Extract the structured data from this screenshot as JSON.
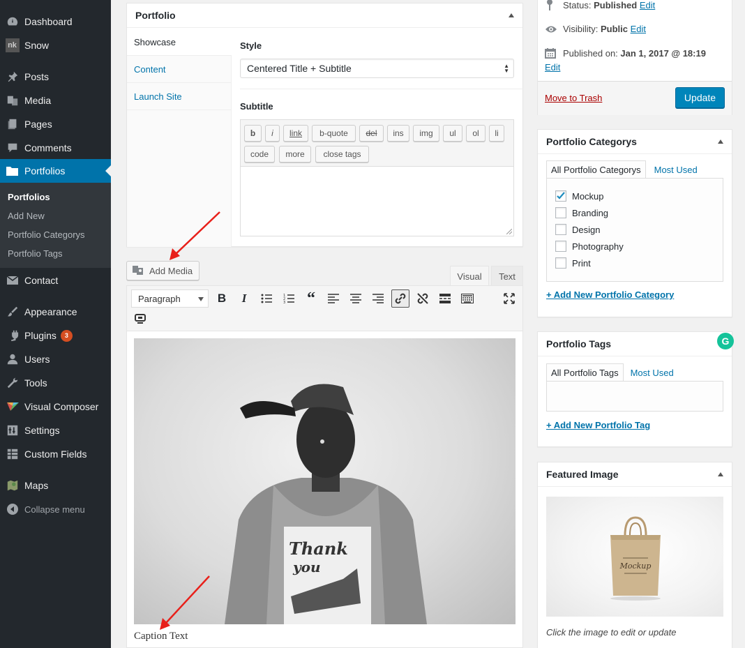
{
  "sidebar": {
    "items": [
      {
        "label": "Dashboard",
        "icon": "dashboard-icon"
      },
      {
        "label": "Snow",
        "icon": "snow-logo-icon"
      },
      {
        "label": "Posts",
        "icon": "pushpin-icon"
      },
      {
        "label": "Media",
        "icon": "media-icon"
      },
      {
        "label": "Pages",
        "icon": "pages-icon"
      },
      {
        "label": "Comments",
        "icon": "comment-bubble-icon"
      },
      {
        "label": "Portfolios",
        "icon": "folder-icon"
      },
      {
        "label": "Contact",
        "icon": "envelope-icon"
      },
      {
        "label": "Appearance",
        "icon": "paint-brush-icon"
      },
      {
        "label": "Plugins",
        "icon": "plug-icon",
        "badge": "3"
      },
      {
        "label": "Users",
        "icon": "user-icon"
      },
      {
        "label": "Tools",
        "icon": "wrench-icon"
      },
      {
        "label": "Visual Composer",
        "icon": "visual-composer-icon"
      },
      {
        "label": "Settings",
        "icon": "settings-icon"
      },
      {
        "label": "Custom Fields",
        "icon": "grid-icon"
      },
      {
        "label": "Maps",
        "icon": "map-icon"
      },
      {
        "label": "Collapse menu",
        "icon": "collapse-arrow-icon"
      }
    ],
    "submenu": [
      "Portfolios",
      "Add New",
      "Portfolio Categorys",
      "Portfolio Tags"
    ],
    "snow_logo_text": "nk"
  },
  "portfolio_box": {
    "title": "Portfolio",
    "tabs": [
      "Showcase",
      "Content",
      "Launch Site"
    ],
    "style_label": "Style",
    "style_value": "Centered Title + Subtitle",
    "subtitle_label": "Subtitle",
    "quicktags": [
      "b",
      "i",
      "link",
      "b-quote",
      "del",
      "ins",
      "img",
      "ul",
      "ol",
      "li",
      "code",
      "more",
      "close tags"
    ]
  },
  "editor": {
    "add_media": "Add Media",
    "tabs": [
      "Visual",
      "Text"
    ],
    "format_select": "Paragraph",
    "caption": "Caption Text",
    "photo_shirt_line1": "Thank",
    "photo_shirt_line2": "you",
    "toolbar_icons": [
      "bold-icon",
      "italic-icon",
      "bullet-list-icon",
      "numbered-list-icon",
      "blockquote-icon",
      "align-left-icon",
      "align-center-icon",
      "align-right-icon",
      "insert-link-icon",
      "remove-link-icon",
      "read-more-icon",
      "toolbar-toggle-icon",
      "fullscreen-icon",
      "visual-composer-icon"
    ]
  },
  "publish": {
    "status_label": "Status:",
    "status_value": "Published",
    "visibility_label": "Visibility:",
    "visibility_value": "Public",
    "published_label": "Published on:",
    "published_value": "Jan 1, 2017 @ 18:19",
    "edit": "Edit",
    "trash": "Move to Trash",
    "update": "Update"
  },
  "categories": {
    "title": "Portfolio Categorys",
    "tabs": [
      "All Portfolio Categorys",
      "Most Used"
    ],
    "items": [
      {
        "label": "Mockup",
        "checked": true
      },
      {
        "label": "Branding",
        "checked": false
      },
      {
        "label": "Design",
        "checked": false
      },
      {
        "label": "Photography",
        "checked": false
      },
      {
        "label": "Print",
        "checked": false
      }
    ],
    "add_link": "+ Add New Portfolio Category"
  },
  "tags": {
    "title": "Portfolio Tags",
    "tabs": [
      "All Portfolio Tags",
      "Most Used"
    ],
    "add_link": "+ Add New Portfolio Tag"
  },
  "featured": {
    "title": "Featured Image",
    "note": "Click the image to edit or update",
    "bag_text": "Mockup"
  },
  "grammarly": {
    "letter": "G"
  },
  "colors": {
    "sidebar_bg": "#23282d",
    "accent": "#0073aa",
    "primary_button": "#0085ba",
    "trash": "#a00000",
    "badge": "#d54e21",
    "annotation_arrow": "#e8201a"
  }
}
